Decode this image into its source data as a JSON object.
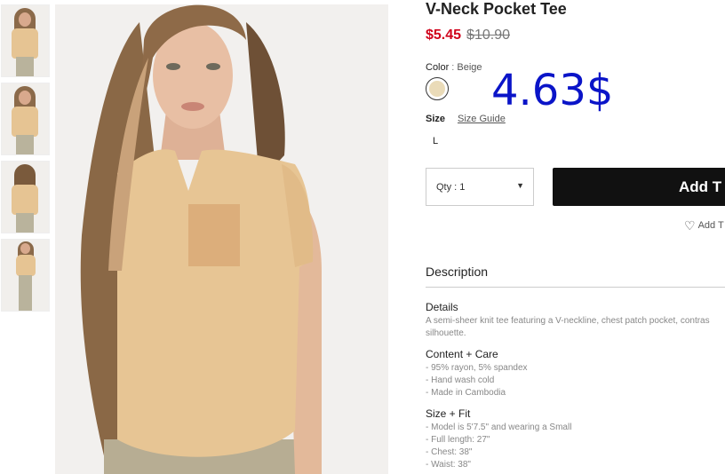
{
  "product": {
    "title": "V-Neck Pocket Tee",
    "sale_price": "$5.45",
    "original_price": "$10.90",
    "overlay_price": "4.63$"
  },
  "color": {
    "label": "Color",
    "separator": ":",
    "value": "Beige",
    "swatch_hex": "#eadbb8"
  },
  "size": {
    "label": "Size",
    "guide_link": "Size Guide",
    "options": [
      "L"
    ]
  },
  "quantity": {
    "label": "Qty : 1"
  },
  "buttons": {
    "add_to_bag": "Add T",
    "add_to_favorites": "Add T"
  },
  "description": {
    "heading": "Description",
    "sections": [
      {
        "title": "Details",
        "lines": [
          "A semi-sheer knit tee featuring a V-neckline, chest patch pocket, contras",
          "silhouette."
        ]
      },
      {
        "title": "Content + Care",
        "lines": [
          "- 95% rayon, 5% spandex",
          "- Hand wash cold",
          "- Made in Cambodia"
        ]
      },
      {
        "title": "Size + Fit",
        "lines": [
          "- Model is 5'7.5\" and wearing a Small",
          "- Full length: 27\"",
          "- Chest: 38\"",
          "- Waist: 38\""
        ]
      }
    ]
  },
  "colors": {
    "sale": "#d0021b",
    "overlay": "#0a14c8",
    "button_bg": "#111111"
  }
}
